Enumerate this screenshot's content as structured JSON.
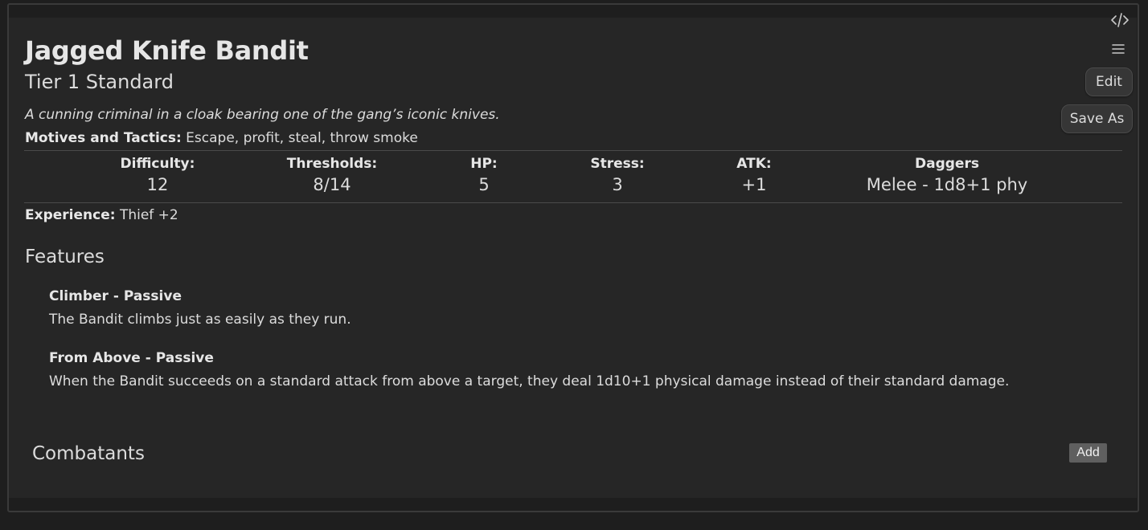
{
  "adversary": {
    "name": "Jagged Knife Bandit",
    "tier_type": "Tier 1 Standard",
    "description": "A cunning criminal in a cloak bearing one of the gang’s iconic knives.",
    "motives_label": "Motives and Tactics:",
    "motives_value": "Escape, profit, steal, throw smoke"
  },
  "stats": [
    {
      "label": "Difficulty:",
      "value": "12"
    },
    {
      "label": "Thresholds:",
      "value": "8/14"
    },
    {
      "label": "HP:",
      "value": "5"
    },
    {
      "label": "Stress:",
      "value": "3"
    },
    {
      "label": "ATK:",
      "value": "+1"
    },
    {
      "label": "Daggers",
      "value": "Melee - 1d8+1 phy"
    }
  ],
  "experience": {
    "label": "Experience:",
    "value": "Thief +2"
  },
  "features": {
    "heading": "Features",
    "items": [
      {
        "name": "Climber - Passive",
        "description": "The Bandit climbs just as easily as they run."
      },
      {
        "name": "From Above - Passive",
        "description": "When the Bandit succeeds on a standard attack from above a target, they deal 1d10+1 physical damage instead of their standard damage."
      }
    ]
  },
  "combatants": {
    "heading": "Combatants",
    "add_label": "Add"
  },
  "toolbar": {
    "code_icon": "code-icon",
    "menu_icon": "menu-icon",
    "edit_label": "Edit",
    "save_as_label": "Save As"
  },
  "colors": {
    "background": "#1e1e1e",
    "card": "#262626",
    "text": "#dcddde",
    "button": "#363636",
    "add_button": "#5f5f5f"
  }
}
